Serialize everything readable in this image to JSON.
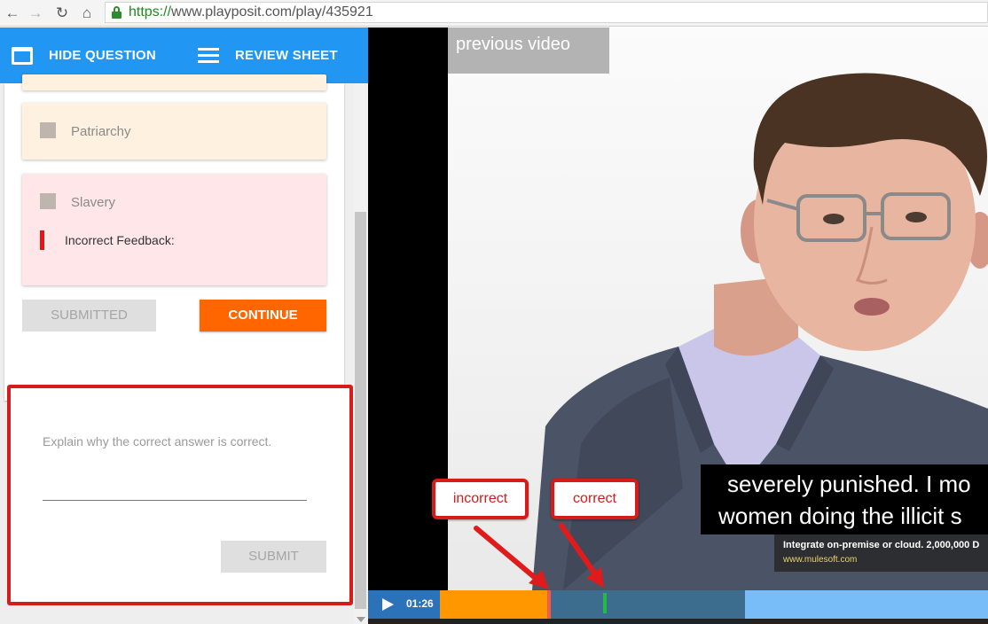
{
  "browser": {
    "url_scheme": "https://",
    "url_rest": "www.playposit.com/play/435921",
    "back_icon": "arrow-left-icon",
    "forward_icon": "arrow-right-icon",
    "reload_icon": "reload-icon",
    "home_icon": "home-icon"
  },
  "header": {
    "hide_question": "HIDE QUESTION",
    "review_sheet": "REVIEW SHEET"
  },
  "question": {
    "options": [
      {
        "label": "Patriarchy"
      },
      {
        "label": "Slavery",
        "feedback": "Incorrect Feedback:"
      }
    ],
    "submitted_label": "SUBMITTED",
    "continue_label": "CONTINUE"
  },
  "explain": {
    "label": "Explain why the correct answer is correct.",
    "input_value": "",
    "submit_label": "SUBMIT"
  },
  "video": {
    "previous_video": "previous video",
    "subtitle_lines": [
      "severely punished. I mo",
      "women doing the illicit s"
    ],
    "ad_text": "Integrate on-premise or cloud. 2,000,000 D",
    "ad_url": "www.mulesoft.com",
    "callouts": {
      "incorrect": "incorrect",
      "correct": "correct"
    },
    "time": "01:26",
    "colors": {
      "played": "#ff9800",
      "buffered": "#3d6d8e",
      "remaining": "#78bdf7",
      "incorrect_marker": "#f55a4a",
      "correct_marker": "#22bb44"
    }
  },
  "colors": {
    "header_blue": "#2196f3",
    "continue_orange": "#ff6600",
    "highlight_red": "#d71a1a"
  }
}
